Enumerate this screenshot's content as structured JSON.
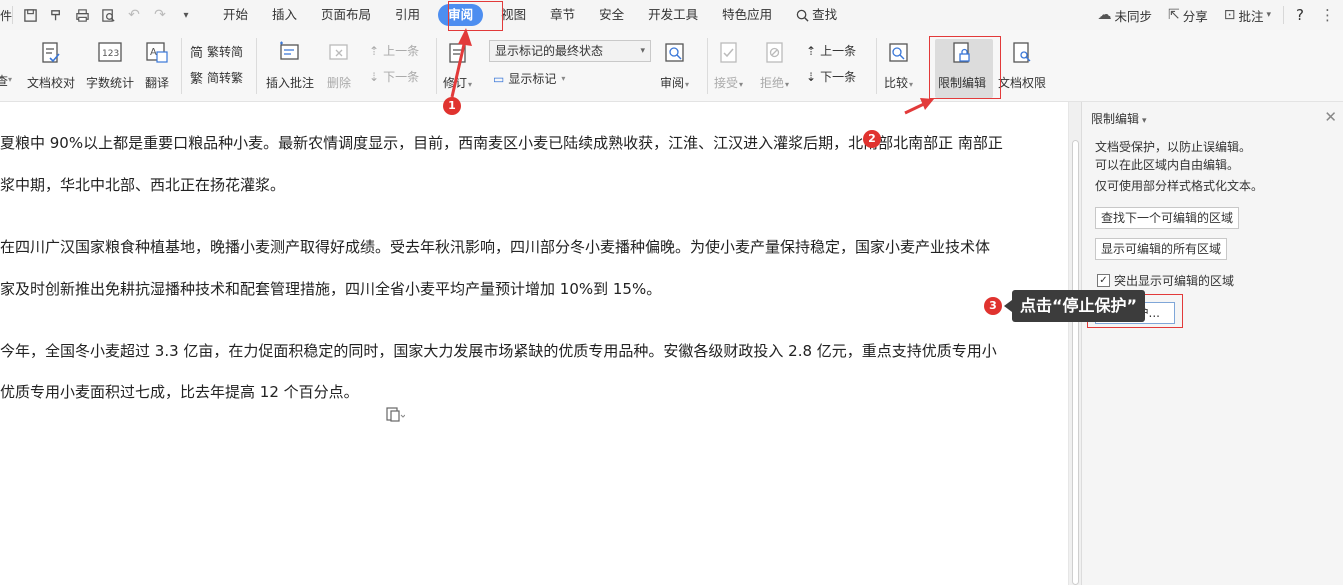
{
  "menubar": {
    "left_fragment": "件",
    "tabs": [
      "开始",
      "插入",
      "页面布局",
      "引用",
      "审阅",
      "视图",
      "章节",
      "安全",
      "开发工具",
      "特色应用"
    ],
    "active_tab": "审阅",
    "search_label": "查找",
    "right": {
      "sync_label": "未同步",
      "share_label": "分享",
      "comment_label": "批注",
      "help_label": "?"
    }
  },
  "ribbon": {
    "frag_label": "查",
    "proof_label": "文档校对",
    "wordcount_label": "字数统计",
    "translate_label": "翻译",
    "to_trad_label": "繁转简",
    "to_simp_label": "简转繁",
    "insert_comment_label": "插入批注",
    "delete_label": "删除",
    "prev_comment_label": "上一条",
    "next_comment_label": "下一条",
    "revise_label": "修订",
    "markup_state_value": "显示标记的最终状态",
    "show_markup_label": "显示标记",
    "review_label": "审阅",
    "accept_label": "接受",
    "reject_label": "拒绝",
    "prev_change_label": "上一条",
    "next_change_label": "下一条",
    "compare_label": "比较",
    "restrict_edit_label": "限制编辑",
    "doc_rights_label": "文档权限"
  },
  "document": {
    "paragraphs": [
      "夏粮中 90%以上都是重要口粮品种小麦。最新农情调度显示，目前，西南麦区小麦已陆续成熟收获，江淮、江汉进入灌浆后期，北南部北南部正 南部正",
      "浆中期，华北中北部、西北正在扬花灌浆。",
      "在四川广汉国家粮食种植基地，晚播小麦测产取得好成绩。受去年秋汛影响，四川部分冬小麦播种偏晚。为使小麦产量保持稳定，国家小麦产业技术体",
      "家及时创新推出免耕抗湿播种技术和配套管理措施，四川全省小麦平均产量预计增加 10%到 15%。",
      "今年，全国冬小麦超过 3.3 亿亩，在力促面积稳定的同时，国家大力发展市场紧缺的优质专用品种。安徽各级财政投入 2.8 亿元，重点支持优质专用小",
      "优质专用小麦面积过七成，比去年提高 12 个百分点。"
    ]
  },
  "pane": {
    "title": "限制编辑",
    "lines": [
      "文档受保护，以防止误编辑。",
      "可以在此区域内自由编辑。",
      "仅可使用部分样式格式化文本。"
    ],
    "find_next_btn": "查找下一个可编辑的区域",
    "show_all_btn": "显示可编辑的所有区域",
    "highlight_label": "突出显示可编辑的区域",
    "highlight_checked": true,
    "stop_btn_visible": "护..."
  },
  "annotations": {
    "badges": [
      "1",
      "2",
      "3"
    ],
    "callout_text": "点击“停止保护”",
    "color": "#e23a3a"
  }
}
